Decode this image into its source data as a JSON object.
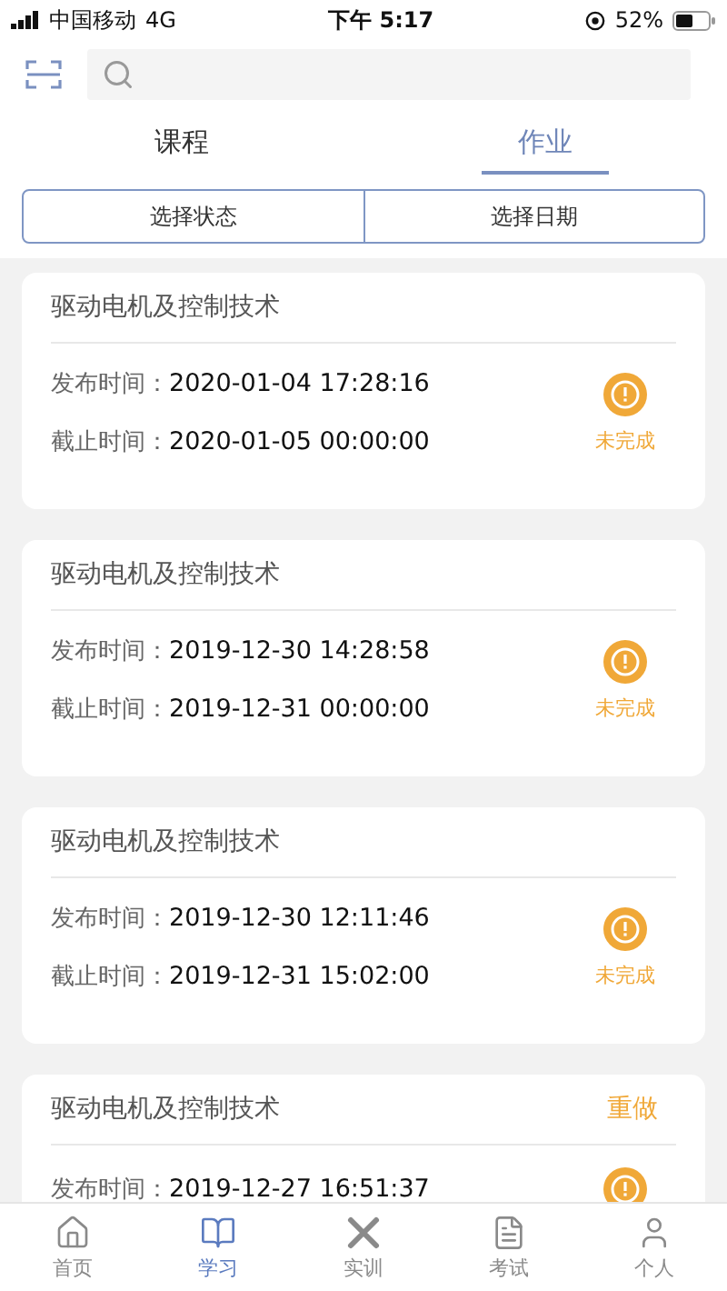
{
  "status_bar": {
    "carrier": "中国移动",
    "network": "4G",
    "time": "下午 5:17",
    "battery": "52%"
  },
  "tabs": [
    {
      "label": "课程",
      "selected": false
    },
    {
      "label": "作业",
      "selected": true
    }
  ],
  "filters": [
    "选择状态",
    "选择日期"
  ],
  "assignments": [
    {
      "title": "驱动电机及控制技术",
      "published_label": "发布时间：",
      "published": "2020-01-04 17:28:16",
      "deadline_label": "截止时间：",
      "deadline": "2020-01-05 00:00:00",
      "status": "未完成"
    },
    {
      "title": "驱动电机及控制技术",
      "published_label": "发布时间：",
      "published": "2019-12-30 14:28:58",
      "deadline_label": "截止时间：",
      "deadline": "2019-12-31 00:00:00",
      "status": "未完成"
    },
    {
      "title": "驱动电机及控制技术",
      "published_label": "发布时间：",
      "published": "2019-12-30 12:11:46",
      "deadline_label": "截止时间：",
      "deadline": "2019-12-31 15:02:00",
      "status": "未完成"
    },
    {
      "title": "驱动电机及控制技术",
      "action": "重做",
      "published_label": "发布时间：",
      "published": "2019-12-27 16:51:37"
    }
  ],
  "nav": [
    {
      "kind": "home",
      "label": "首页",
      "selected": false
    },
    {
      "kind": "study",
      "label": "学习",
      "selected": true
    },
    {
      "kind": "training",
      "label": "实训",
      "selected": false
    },
    {
      "kind": "exam",
      "label": "考试",
      "selected": false
    },
    {
      "kind": "profile",
      "label": "个人",
      "selected": false
    }
  ]
}
